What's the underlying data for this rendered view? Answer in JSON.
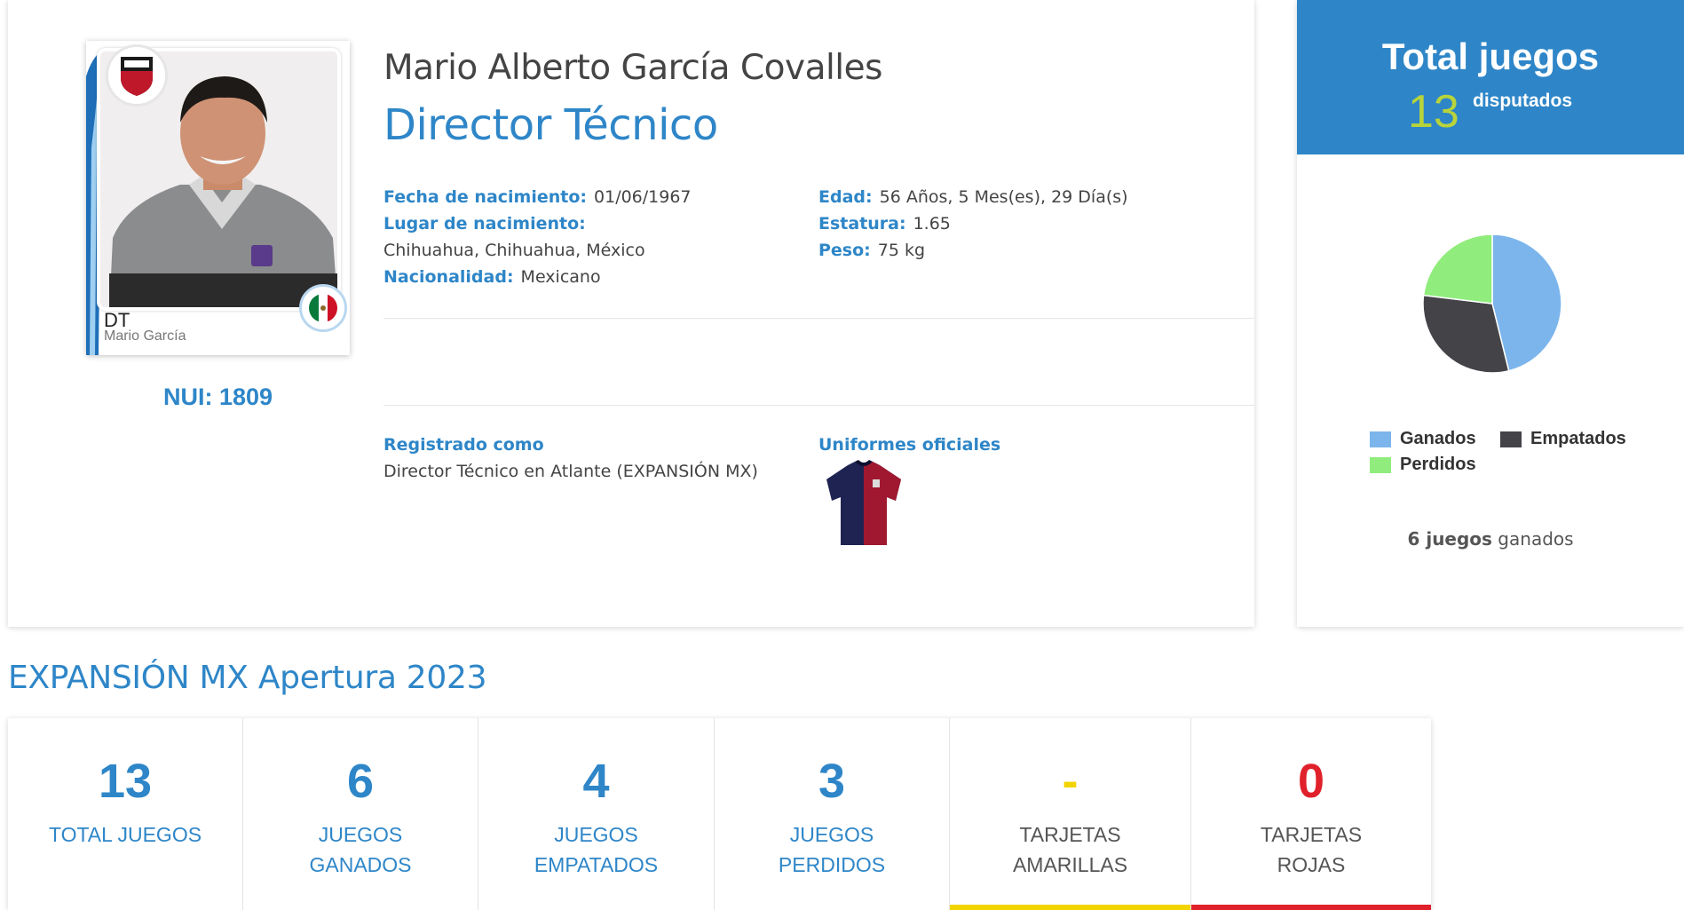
{
  "player": {
    "name": "Mario Alberto García Covalles",
    "role": "Director Técnico",
    "nui": "NUI: 1809",
    "card_position": "DT",
    "card_name": "Mario García"
  },
  "details": {
    "birth_date_label": "Fecha de nacimiento:",
    "birth_date": "01/06/1967",
    "birth_place_label": "Lugar de nacimiento:",
    "birth_place": "Chihuahua, Chihuahua, México",
    "nationality_label": "Nacionalidad:",
    "nationality": "Mexicano",
    "age_label": "Edad:",
    "age": "56 Años, 5 Mes(es), 29 Día(s)",
    "height_label": "Estatura:",
    "height": "1.65",
    "weight_label": "Peso:",
    "weight": "75 kg"
  },
  "registration": {
    "label": "Registrado como",
    "value": "Director Técnico en Atlante (EXPANSIÓN MX)",
    "uniforms_label": "Uniformes oficiales"
  },
  "totals": {
    "title": "Total juegos",
    "count": "13",
    "subtitle": "disputados",
    "won_count": "6 juegos",
    "won_suffix": " ganados"
  },
  "chart_data": {
    "type": "pie",
    "categories": [
      "Ganados",
      "Empatados",
      "Perdidos"
    ],
    "values": [
      6,
      4,
      3
    ],
    "colors": [
      "#7cb5ec",
      "#434348",
      "#90ed7d"
    ],
    "legend": "bottom"
  },
  "season": {
    "title": "EXPANSIÓN MX Apertura 2023",
    "stats": [
      {
        "value": "13",
        "label": "TOTAL JUEGOS",
        "color": "#2e86c8"
      },
      {
        "value": "6",
        "label": "JUEGOS GANADOS",
        "color": "#2e86c8"
      },
      {
        "value": "4",
        "label": "JUEGOS EMPATADOS",
        "color": "#2e86c8"
      },
      {
        "value": "3",
        "label": "JUEGOS PERDIDOS",
        "color": "#2e86c8"
      },
      {
        "value": "-",
        "label": "TARJETAS AMARILLAS",
        "color": "#f2d400"
      },
      {
        "value": "0",
        "label": "TARJETAS ROJAS",
        "color": "#e0202a"
      }
    ]
  }
}
